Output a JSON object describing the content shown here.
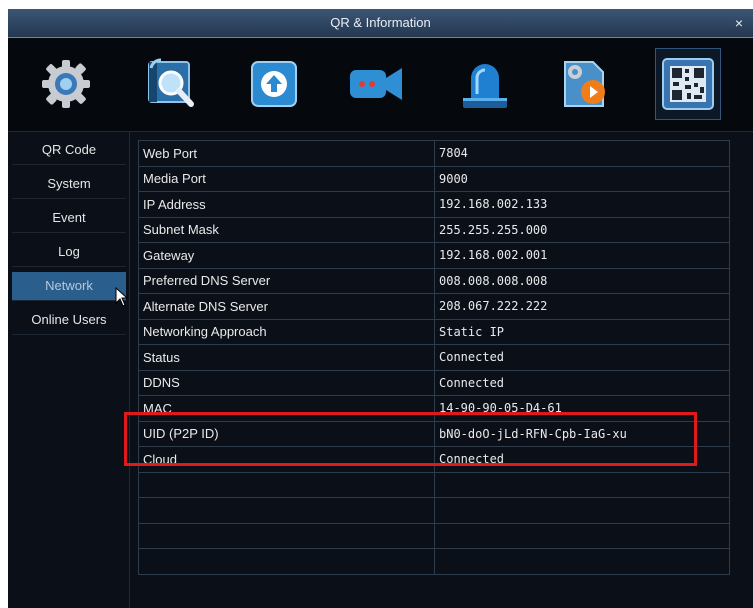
{
  "window": {
    "title": "QR & Information",
    "close_label": "×"
  },
  "toolbar": {
    "icons": [
      {
        "name": "settings-gear-icon"
      },
      {
        "name": "search-playback-icon"
      },
      {
        "name": "backup-upload-icon"
      },
      {
        "name": "camera-record-icon"
      },
      {
        "name": "alarm-siren-icon"
      },
      {
        "name": "advanced-settings-icon"
      },
      {
        "name": "qr-information-icon"
      }
    ]
  },
  "sidebar": {
    "items": [
      {
        "label": "QR Code"
      },
      {
        "label": "System"
      },
      {
        "label": "Event"
      },
      {
        "label": "Log"
      },
      {
        "label": "Network"
      },
      {
        "label": "Online Users"
      }
    ],
    "selected": "Network"
  },
  "network_table": {
    "rows": [
      {
        "label": "Web Port",
        "value": "7804"
      },
      {
        "label": "Media Port",
        "value": "9000"
      },
      {
        "label": "IP Address",
        "value": "192.168.002.133"
      },
      {
        "label": "Subnet Mask",
        "value": "255.255.255.000"
      },
      {
        "label": "Gateway",
        "value": "192.168.002.001"
      },
      {
        "label": "Preferred DNS Server",
        "value": "008.008.008.008"
      },
      {
        "label": "Alternate DNS Server",
        "value": "208.067.222.222"
      },
      {
        "label": "Networking Approach",
        "value": "Static IP"
      },
      {
        "label": "Status",
        "value": "Connected"
      },
      {
        "label": "DDNS",
        "value": "Connected"
      },
      {
        "label": "MAC",
        "value": "14-90-90-05-D4-61"
      },
      {
        "label": "UID (P2P ID)",
        "value": "bN0-doO-jLd-RFN-Cpb-IaG-xu"
      },
      {
        "label": "Cloud",
        "value": "Connected"
      },
      {
        "label": "",
        "value": ""
      },
      {
        "label": "",
        "value": ""
      },
      {
        "label": "",
        "value": ""
      },
      {
        "label": "",
        "value": ""
      }
    ]
  },
  "colors": {
    "highlight": "#e01a1a",
    "selected_nav": "#2a5e8c",
    "title_bar": "#2e4562"
  }
}
